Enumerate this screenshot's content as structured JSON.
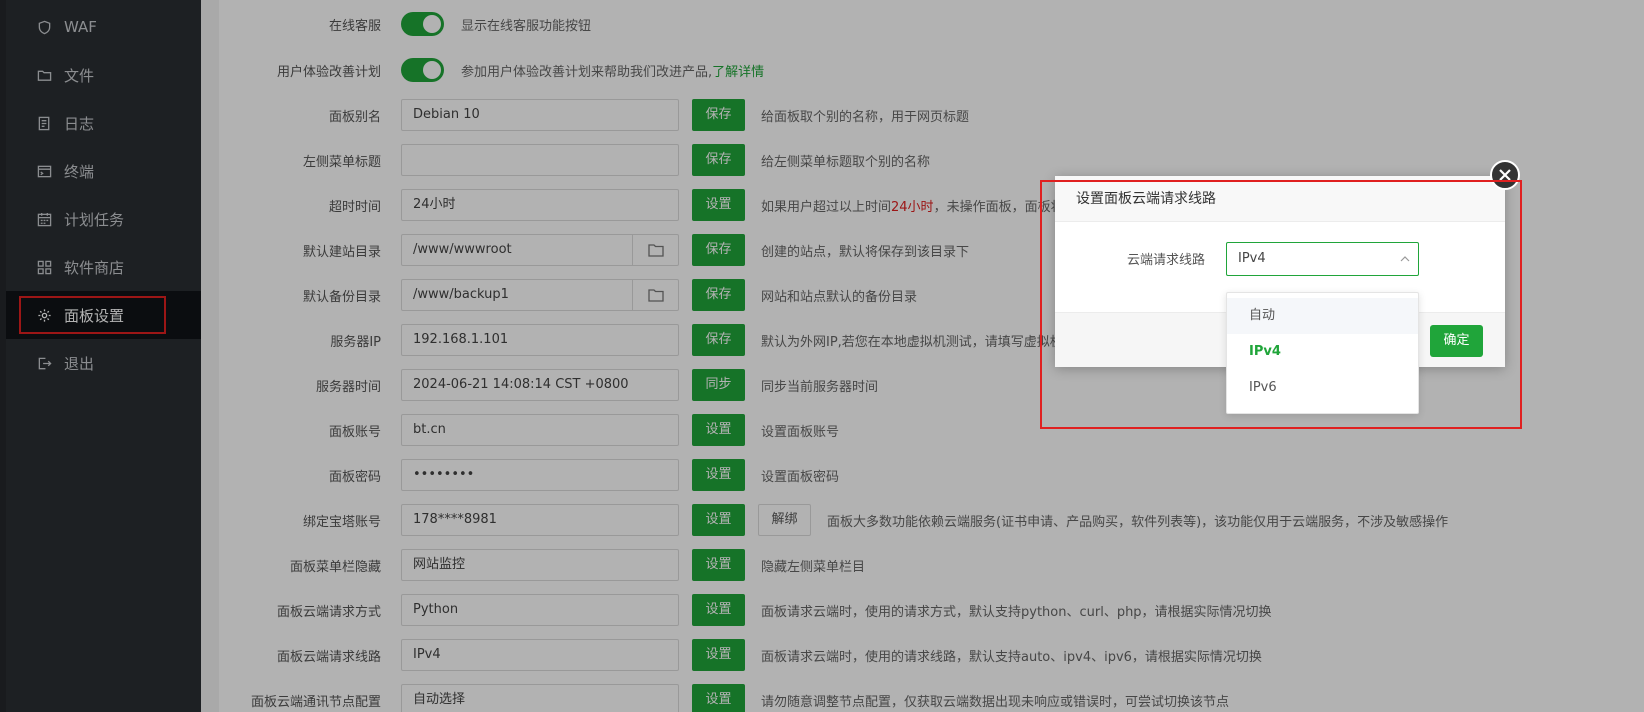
{
  "sidebar": {
    "items": [
      {
        "label": "WAF",
        "icon": "shield-icon"
      },
      {
        "label": "文件",
        "icon": "folder-icon"
      },
      {
        "label": "日志",
        "icon": "log-icon"
      },
      {
        "label": "终端",
        "icon": "terminal-icon"
      },
      {
        "label": "计划任务",
        "icon": "calendar-icon"
      },
      {
        "label": "软件商店",
        "icon": "apps-icon"
      },
      {
        "label": "面板设置",
        "icon": "gear-icon",
        "active": true
      },
      {
        "label": "退出",
        "icon": "logout-icon"
      }
    ]
  },
  "settings": {
    "online_service": {
      "label": "在线客服",
      "desc": "显示在线客服功能按钮"
    },
    "ux_plan": {
      "label": "用户体验改善计划",
      "desc": "参加用户体验改善计划来帮助我们改进产品,",
      "link": "了解详情"
    },
    "rows": [
      {
        "label": "面板别名",
        "value": "Debian 10",
        "button": "保存",
        "desc": "给面板取个别的名称，用于网页标题"
      },
      {
        "label": "左侧菜单标题",
        "value": "",
        "button": "保存",
        "desc": "给左侧菜单标题取个别的名称"
      },
      {
        "label": "超时时间",
        "value": "24小时",
        "button": "设置",
        "desc_pre": "如果用户超过以上时间",
        "desc_red": "24小时",
        "desc_post": "，未操作面板，面板将"
      },
      {
        "label": "默认建站目录",
        "value": "/www/wwwroot",
        "button": "保存",
        "desc": "创建的站点，默认将保存到该目录下",
        "folder": true
      },
      {
        "label": "默认备份目录",
        "value": "/www/backup1",
        "button": "保存",
        "desc": "网站和站点默认的备份目录",
        "folder": true
      },
      {
        "label": "服务器IP",
        "value": "192.168.1.101",
        "button": "保存",
        "desc": "默认为外网IP,若您在本地虚拟机测试，请填写虚拟机"
      },
      {
        "label": "服务器时间",
        "value": "2024-06-21 14:08:14 CST +0800",
        "button": "同步",
        "desc": "同步当前服务器时间"
      },
      {
        "label": "面板账号",
        "value": "bt.cn",
        "button": "设置",
        "desc": "设置面板账号"
      },
      {
        "label": "面板密码",
        "value": "••••••••",
        "button": "设置",
        "desc": "设置面板密码"
      },
      {
        "label": "绑定宝塔账号",
        "value": "178****8981",
        "button": "设置",
        "unbind": "解绑",
        "desc": "面板大多数功能依赖云端服务(证书申请、产品购买，软件列表等)，该功能仅用于云端服务，不涉及敏感操作"
      },
      {
        "label": "面板菜单栏隐藏",
        "value": "网站监控",
        "button": "设置",
        "desc": "隐藏左侧菜单栏目"
      },
      {
        "label": "面板云端请求方式",
        "value": "Python",
        "button": "设置",
        "desc": "面板请求云端时，使用的请求方式，默认支持python、curl、php，请根据实际情况切换"
      },
      {
        "label": "面板云端请求线路",
        "value": "IPv4",
        "button": "设置",
        "desc": "面板请求云端时，使用的请求线路，默认支持auto、ipv4、ipv6，请根据实际情况切换"
      },
      {
        "label": "面板云端通讯节点配置",
        "value": "自动选择",
        "button": "设置",
        "desc": "请勿随意调整节点配置，仅获取云端数据出现未响应或错误时，可尝试切换该节点"
      }
    ]
  },
  "dialog": {
    "title": "设置面板云端请求线路",
    "field_label": "云端请求线路",
    "selected": "IPv4",
    "ok": "确定",
    "options": [
      "自动",
      "IPv4",
      "IPv6"
    ]
  },
  "colors": {
    "accent": "#20a53a",
    "highlight": "#e02020",
    "sidebar": "#2a2e33"
  }
}
